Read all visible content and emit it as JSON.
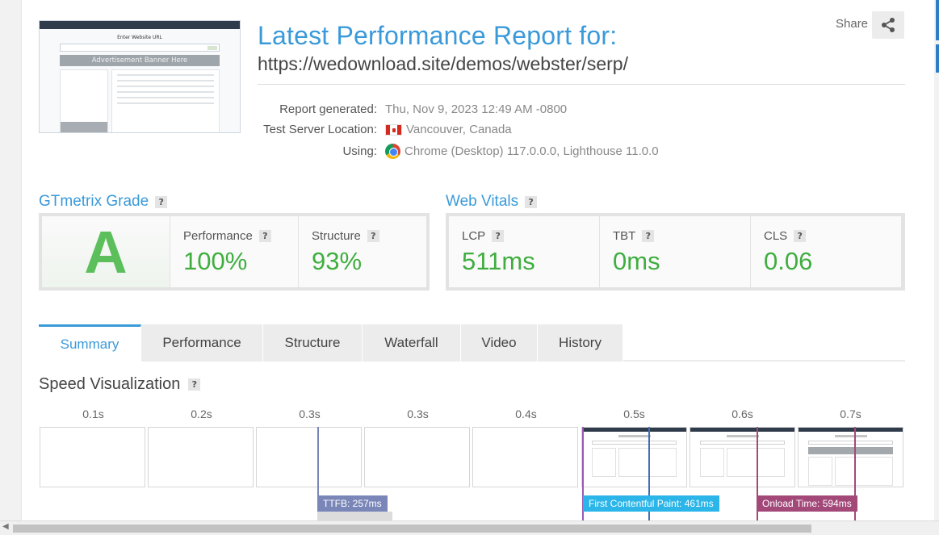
{
  "report": {
    "title": "Latest Performance Report for:",
    "url": "https://wedownload.site/demos/webster/serp/",
    "share_label": "Share",
    "meta": [
      {
        "label": "Report generated:",
        "value": "Thu, Nov 9, 2023 12:49 AM -0800",
        "icon": "none"
      },
      {
        "label": "Test Server Location:",
        "value": "Vancouver, Canada",
        "icon": "canada-flag-icon"
      },
      {
        "label": "Using:",
        "value": "Chrome (Desktop) 117.0.0.0, Lighthouse 11.0.0",
        "icon": "chrome-icon"
      }
    ]
  },
  "thumbnail": {
    "title": "Enter Website URL",
    "banner": "Advertisement Banner Here"
  },
  "grade": {
    "heading": "GTmetrix Grade",
    "letter": "A",
    "performance_label": "Performance",
    "performance_value": "100%",
    "structure_label": "Structure",
    "structure_value": "93%"
  },
  "vitals": {
    "heading": "Web Vitals",
    "lcp_label": "LCP",
    "lcp_value": "511ms",
    "tbt_label": "TBT",
    "tbt_value": "0ms",
    "cls_label": "CLS",
    "cls_value": "0.06"
  },
  "help_glyph": "?",
  "tabs": [
    "Summary",
    "Performance",
    "Structure",
    "Waterfall",
    "Video",
    "History"
  ],
  "speed": {
    "heading": "Speed Visualization",
    "frames": [
      "0.1s",
      "0.2s",
      "0.3s",
      "0.3s",
      "0.4s",
      "0.5s",
      "0.6s",
      "0.7s"
    ],
    "markers": {
      "ttfb": "TTFB: 257ms",
      "fcp": "First Contentful Paint: 461ms",
      "onload": "Onload Time: 594ms"
    }
  },
  "colors": {
    "accent": "#3a9ad9",
    "good": "#3fae3f",
    "ttfb": "#7a86b8",
    "fcp": "#2bb5e8",
    "onload": "#a3497a",
    "lcp_line": "#3f6fb5",
    "purple_line": "#9b59b6"
  }
}
